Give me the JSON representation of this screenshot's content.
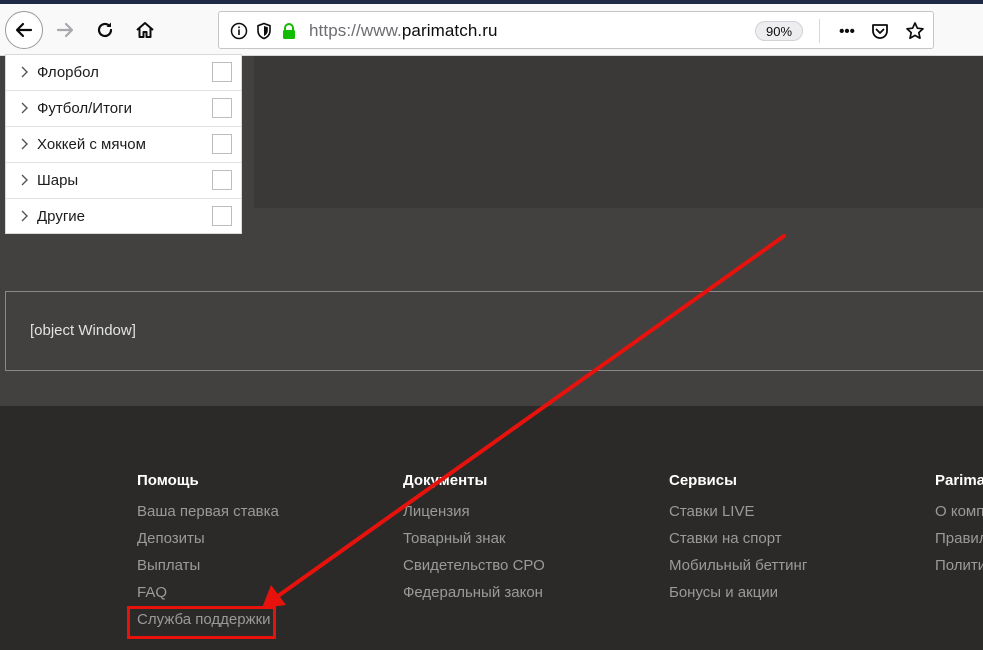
{
  "browser": {
    "url_protocol": "https://www.",
    "url_host": "parimatch.ru",
    "zoom": "90%",
    "more_label": "•••"
  },
  "dropdown": {
    "items": [
      {
        "label": "Флорбол"
      },
      {
        "label": "Футбол/Итоги"
      },
      {
        "label": "Хоккей с мячом"
      },
      {
        "label": "Шары"
      },
      {
        "label": "Другие"
      }
    ]
  },
  "window_box": {
    "text": "[object Window]"
  },
  "footer": {
    "columns": [
      {
        "title": "Помощь",
        "links": [
          "Ваша первая ставка",
          "Депозиты",
          "Выплаты",
          "FAQ",
          "Служба поддержки"
        ]
      },
      {
        "title": "Документы",
        "links": [
          "Лицензия",
          "Товарный знак",
          "Свидетельство СРО",
          "Федеральный закон"
        ]
      },
      {
        "title": "Сервисы",
        "links": [
          "Ставки LIVE",
          "Ставки на спорт",
          "Мобильный беттинг",
          "Бонусы и акции"
        ]
      },
      {
        "title": "Parimatch",
        "links": [
          "О компании",
          "Правила",
          "Политика"
        ]
      }
    ]
  },
  "colors": {
    "annotation": "#e8120c",
    "secure_lock": "#12bc00",
    "footer_bg": "#2b2a29"
  }
}
